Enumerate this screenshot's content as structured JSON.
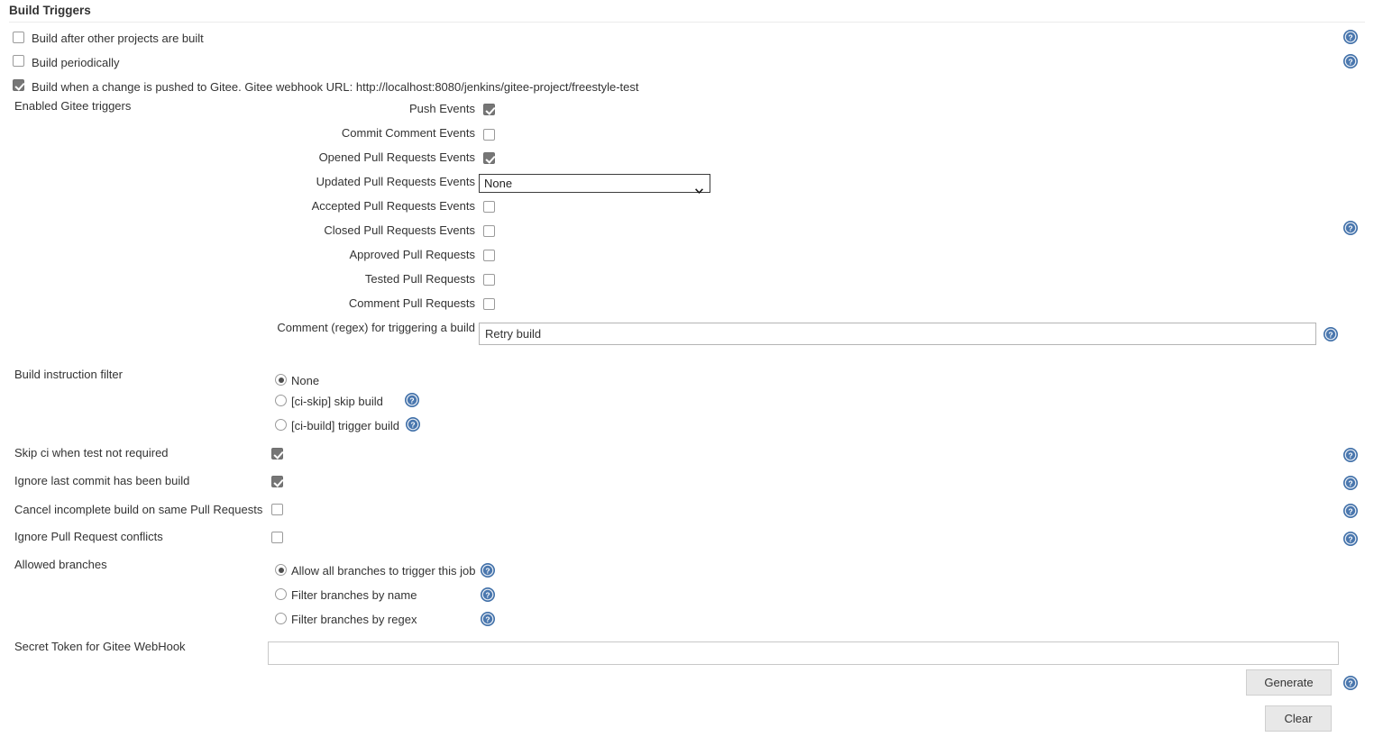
{
  "section": {
    "title": "Build Triggers"
  },
  "top_triggers": [
    {
      "label": "Build after other projects are built",
      "checked": false
    },
    {
      "label": "Build periodically",
      "checked": false
    },
    {
      "label": "Build when a change is pushed to Gitee. Gitee webhook URL: http://localhost:8080/jenkins/gitee-project/freestyle-test",
      "checked": true
    }
  ],
  "enabled_triggers": {
    "label": "Enabled Gitee triggers",
    "events": [
      {
        "label": "Push Events",
        "checked": true
      },
      {
        "label": "Commit Comment Events",
        "checked": false
      },
      {
        "label": "Opened Pull Requests Events",
        "checked": true
      }
    ],
    "updated_pr": {
      "label": "Updated Pull Requests Events",
      "selected": "None"
    },
    "events2": [
      {
        "label": "Accepted Pull Requests Events",
        "checked": false
      },
      {
        "label": "Closed Pull Requests Events",
        "checked": false
      },
      {
        "label": "Approved Pull Requests",
        "checked": false
      },
      {
        "label": "Tested Pull Requests",
        "checked": false
      },
      {
        "label": "Comment Pull Requests",
        "checked": false
      }
    ],
    "comment_regex": {
      "label": "Comment (regex) for triggering a build",
      "value": "Retry build"
    }
  },
  "build_instruction_filter": {
    "label": "Build instruction filter",
    "options": [
      {
        "label": "None",
        "selected": true,
        "help": false
      },
      {
        "label": "[ci-skip] skip build",
        "selected": false,
        "help": true
      },
      {
        "label": "[ci-build] trigger build",
        "selected": false,
        "help": true
      }
    ]
  },
  "flags": [
    {
      "label": "Skip ci when test not required",
      "checked": true
    },
    {
      "label": "Ignore last commit has been build",
      "checked": true
    },
    {
      "label": "Cancel incomplete build on same Pull Requests",
      "checked": false
    },
    {
      "label": "Ignore Pull Request conflicts",
      "checked": false
    }
  ],
  "allowed_branches": {
    "label": "Allowed branches",
    "options": [
      {
        "label": "Allow all branches to trigger this job",
        "selected": true
      },
      {
        "label": "Filter branches by name",
        "selected": false
      },
      {
        "label": "Filter branches by regex",
        "selected": false
      }
    ]
  },
  "secret_token": {
    "label": "Secret Token for Gitee WebHook",
    "value": "",
    "placeholder": ""
  },
  "buttons": {
    "generate": "Generate",
    "clear": "Clear"
  },
  "icons": {
    "help": "help-icon",
    "chevron": "chevron-down-icon"
  },
  "colors": {
    "help_blue": "#3f6fa8",
    "checkbox_fill": "#767676",
    "text": "#333333"
  }
}
